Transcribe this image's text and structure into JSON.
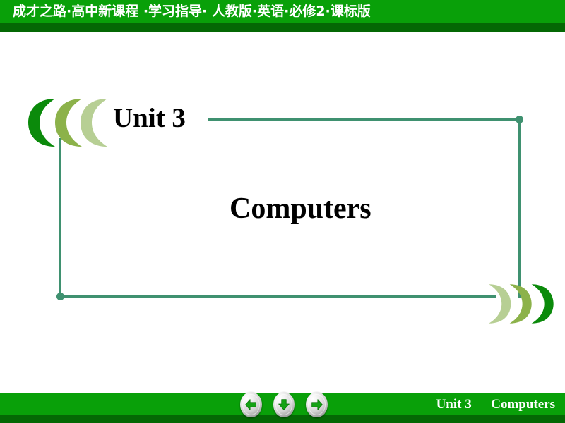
{
  "header": {
    "title": "成才之路·高中新课程 ·学习指导· 人教版·英语·必修2·课标版",
    "bar_color": "#09a009",
    "shadow_color": "#046804",
    "text_color": "#ffffff"
  },
  "slide": {
    "unit_label": "Unit 3",
    "main_title": "Computers",
    "frame_color": "#3f9170",
    "text_color": "#000000"
  },
  "decorations": {
    "left_chevron": {
      "name": "left-chevron-ornament",
      "direction": "left",
      "colors": [
        "#a8c47e",
        "#8cb24a",
        "#0b8a0b"
      ]
    },
    "right_chevron": {
      "name": "right-chevron-ornament",
      "direction": "right",
      "colors": [
        "#b7cf94",
        "#8cb24a",
        "#0b8a0b"
      ]
    }
  },
  "footer": {
    "unit_label": "Unit 3",
    "title": "Computers",
    "bar_color": "#09a009",
    "shadow_color": "#046804",
    "text_color": "#ffffff",
    "nav_buttons": [
      {
        "name": "previous-slide-button",
        "icon": "arrow-left-icon",
        "label": "Previous"
      },
      {
        "name": "down-slide-button",
        "icon": "arrow-down-icon",
        "label": "Down"
      },
      {
        "name": "next-slide-button",
        "icon": "arrow-right-icon",
        "label": "Next"
      }
    ],
    "arrow_color": "#15a315"
  }
}
